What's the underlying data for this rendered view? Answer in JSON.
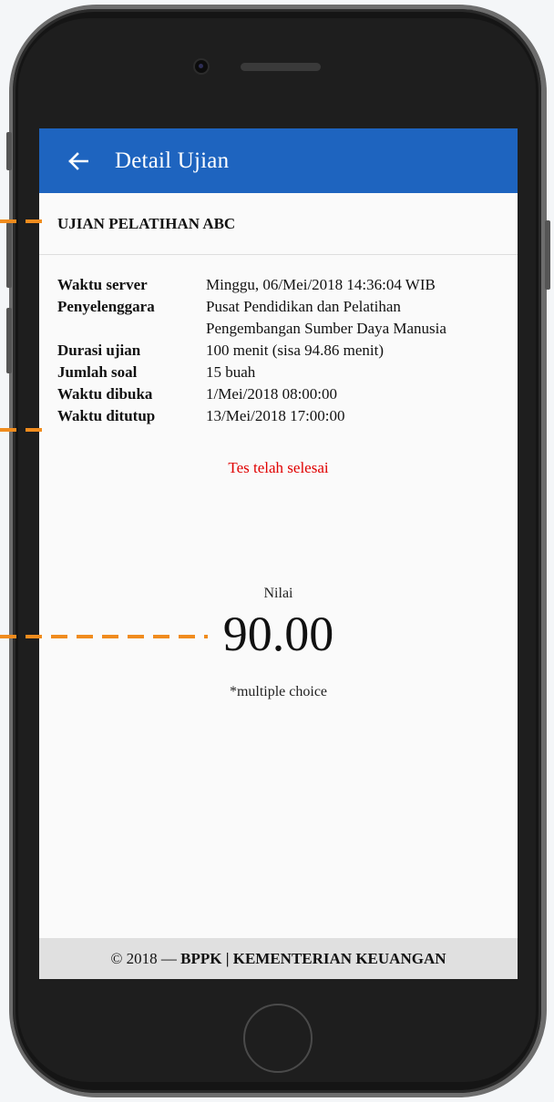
{
  "app_bar": {
    "title": "Detail Ujian",
    "back_icon": "arrow-left-icon"
  },
  "exam": {
    "name": "UJIAN PELATIHAN ABC"
  },
  "details": {
    "rows": [
      {
        "label": "Waktu server",
        "value": [
          "Minggu, 06/Mei/2018 14:36:04 WIB"
        ]
      },
      {
        "label": "Penyelenggara",
        "value": [
          "Pusat Pendidikan dan Pelatihan",
          "Pengembangan Sumber Daya Manusia"
        ]
      },
      {
        "label": "Durasi ujian",
        "value": [
          "100 menit (sisa 94.86 menit)"
        ]
      },
      {
        "label": "Jumlah soal",
        "value": [
          "15 buah"
        ]
      },
      {
        "label": "Waktu dibuka",
        "value": [
          "1/Mei/2018 08:00:00"
        ]
      },
      {
        "label": "Waktu ditutup",
        "value": [
          "13/Mei/2018 17:00:00"
        ]
      }
    ]
  },
  "status": {
    "text": "Tes telah selesai",
    "color": "#e00000"
  },
  "score": {
    "label": "Nilai",
    "value": "90.00",
    "note": "*multiple choice"
  },
  "footer": {
    "prefix": "© 2018 — ",
    "org": "BPPK | KEMENTERIAN KEUANGAN"
  },
  "colors": {
    "app_bar": "#1e64bf",
    "callout": "#f08c1e"
  }
}
